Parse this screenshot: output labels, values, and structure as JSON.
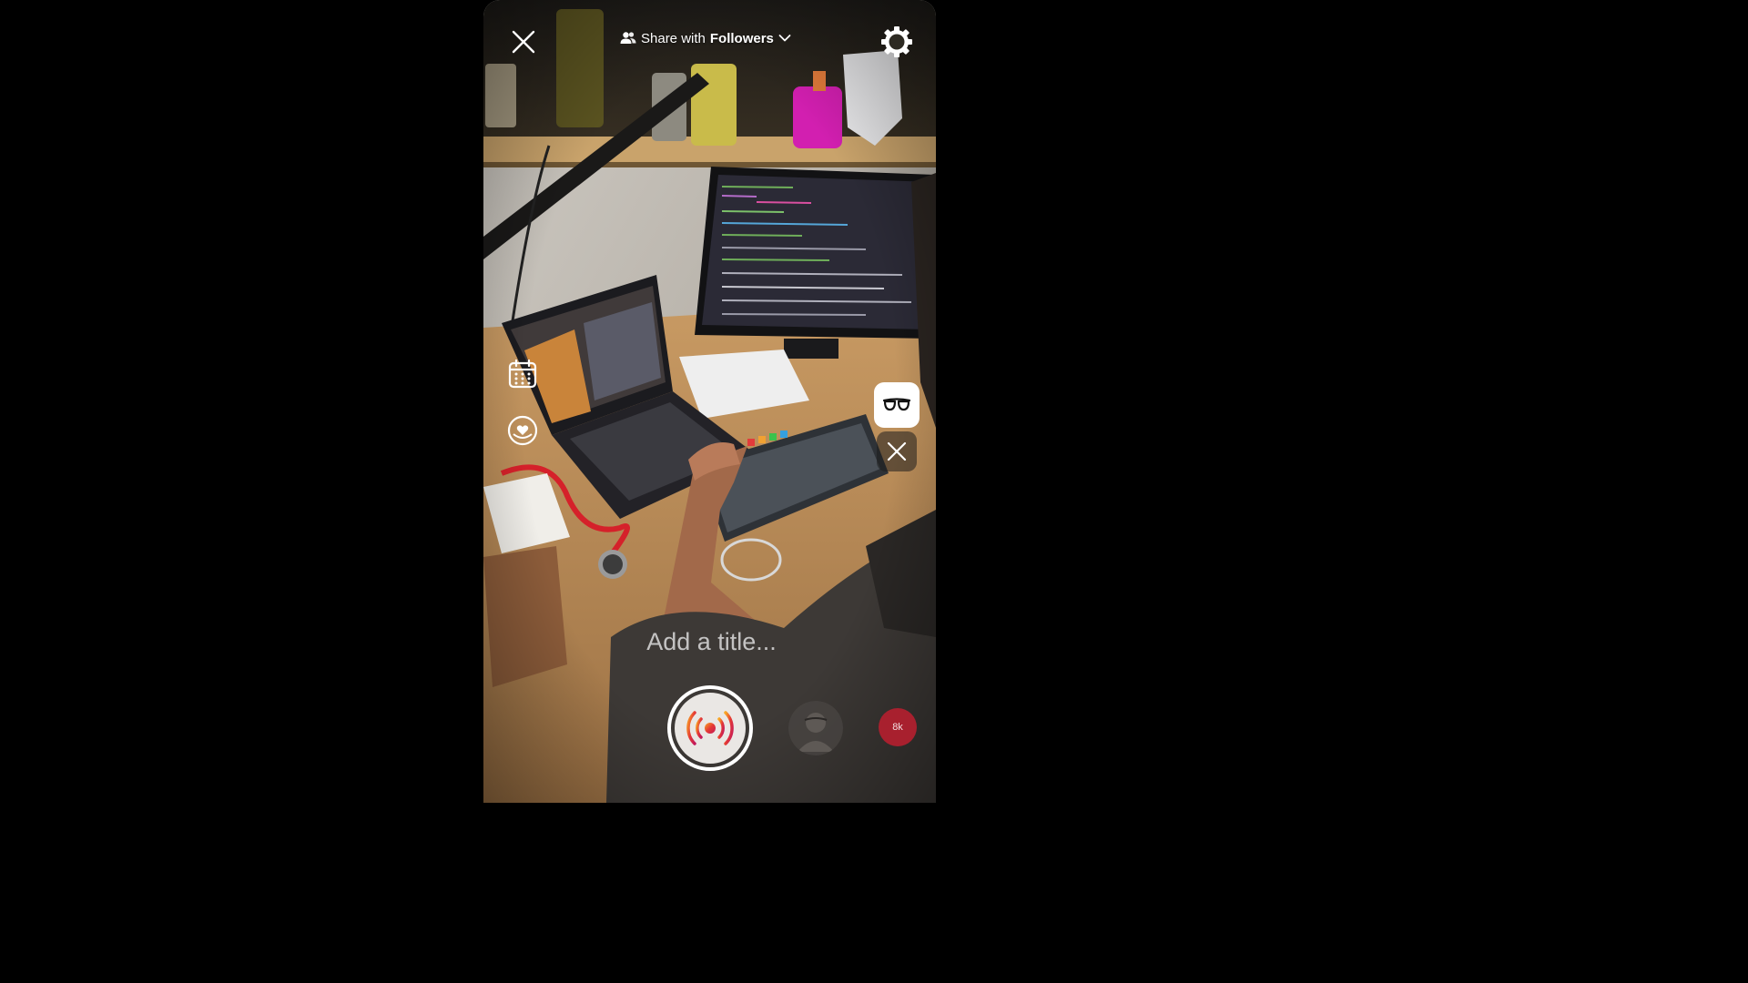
{
  "top_bar": {
    "share_prefix": "Share with",
    "share_audience": "Followers"
  },
  "title_input": {
    "placeholder": "Add a title..."
  },
  "bottom_bar": {
    "viewer_badge": "8k"
  },
  "icons": {
    "close": "close-icon",
    "audience": "people-icon",
    "dropdown": "chevron-down-icon",
    "settings": "gear-icon",
    "schedule": "calendar-icon",
    "fundraiser": "heart-badge-icon",
    "effect": "glasses-icon",
    "remove_effect": "close-icon",
    "go_live": "live-broadcast-icon"
  },
  "colors": {
    "live_gradient_start": "#f9a825",
    "live_gradient_mid": "#e53935",
    "live_gradient_end": "#c2185b",
    "badge": "#a8202e"
  }
}
